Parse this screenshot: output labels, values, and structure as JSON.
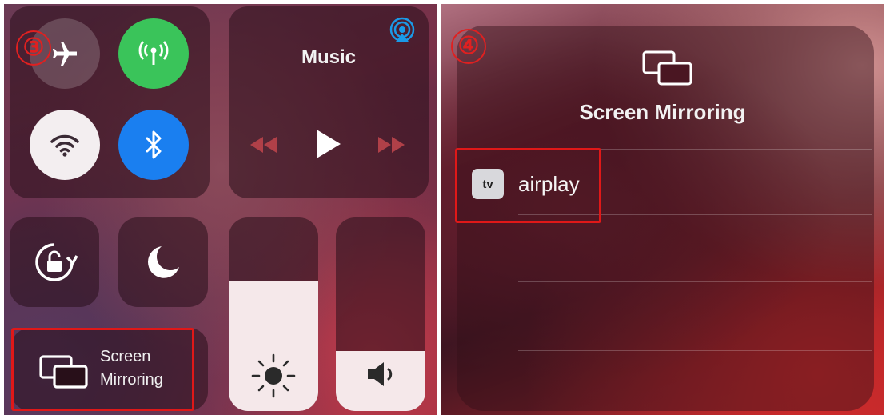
{
  "left": {
    "step_number": "③",
    "music": {
      "title": "Music"
    },
    "screen_mirroring_tile": {
      "line1": "Screen",
      "line2": "Mirroring"
    },
    "brightness_level": 0.67,
    "volume_level": 0.31,
    "colors": {
      "cellular": "#3ac45a",
      "bluetooth": "#1a7ff0",
      "wifi": "#f3eef0"
    }
  },
  "right": {
    "step_number": "④",
    "title": "Screen Mirroring",
    "device": {
      "badge": "tv",
      "name": "airplay"
    }
  },
  "highlight_color": "#e01818"
}
